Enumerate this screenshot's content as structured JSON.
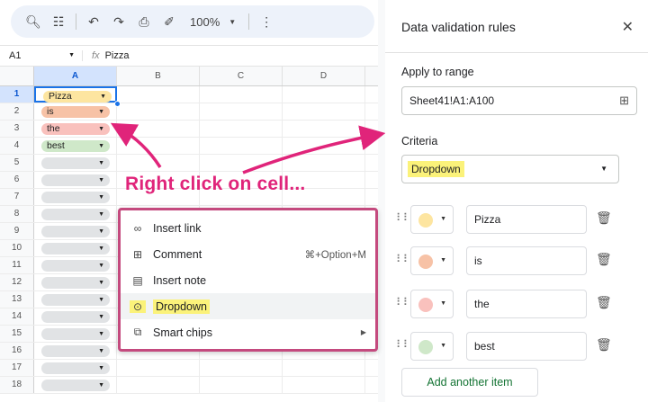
{
  "toolbar": {
    "zoom": "100%",
    "icons": [
      "search-icon",
      "menus-icon",
      "undo-icon",
      "redo-icon",
      "print-icon",
      "paint-format-icon",
      "more-icon"
    ]
  },
  "formula": {
    "cell_ref": "A1",
    "fx": "fx",
    "content": "Pizza"
  },
  "columns": [
    "A",
    "B",
    "C",
    "D"
  ],
  "rows": [
    {
      "n": "1",
      "chip": "Pizza",
      "color": "#fde5a0"
    },
    {
      "n": "2",
      "chip": "is",
      "color": "#f7c2a6"
    },
    {
      "n": "3",
      "chip": "the",
      "color": "#f9c1bd"
    },
    {
      "n": "4",
      "chip": "best",
      "color": "#cfe8c9"
    },
    {
      "n": "5",
      "chip": "",
      "color": "#e1e3e5"
    },
    {
      "n": "6",
      "chip": "",
      "color": "#e1e3e5"
    },
    {
      "n": "7",
      "chip": "",
      "color": "#e1e3e5"
    },
    {
      "n": "8",
      "chip": "",
      "color": "#e1e3e5"
    },
    {
      "n": "9",
      "chip": "",
      "color": "#e1e3e5"
    },
    {
      "n": "10",
      "chip": "",
      "color": "#e1e3e5"
    },
    {
      "n": "11",
      "chip": "",
      "color": "#e1e3e5"
    },
    {
      "n": "12",
      "chip": "",
      "color": "#e1e3e5"
    },
    {
      "n": "13",
      "chip": "",
      "color": "#e1e3e5"
    },
    {
      "n": "14",
      "chip": "",
      "color": "#e1e3e5"
    },
    {
      "n": "15",
      "chip": "",
      "color": "#e1e3e5"
    },
    {
      "n": "16",
      "chip": "",
      "color": "#e1e3e5"
    },
    {
      "n": "17",
      "chip": "",
      "color": "#e1e3e5"
    },
    {
      "n": "18",
      "chip": "",
      "color": "#e1e3e5"
    }
  ],
  "annotation": "Right click on cell...",
  "context_menu": {
    "insert_link": "Insert link",
    "comment": "Comment",
    "comment_shortcut": "⌘+Option+M",
    "insert_note": "Insert note",
    "dropdown": "Dropdown",
    "smart_chips": "Smart chips"
  },
  "panel": {
    "title": "Data validation rules",
    "apply_label": "Apply to range",
    "range_value": "Sheet41!A1:A100",
    "criteria_label": "Criteria",
    "criteria_value": "Dropdown",
    "items": [
      {
        "value": "Pizza",
        "color": "#fde5a0"
      },
      {
        "value": "is",
        "color": "#f7c2a6"
      },
      {
        "value": "the",
        "color": "#f9c1bd"
      },
      {
        "value": "best",
        "color": "#cfe8c9"
      }
    ],
    "add_button": "Add another item"
  },
  "accent_pink": "#e0247a"
}
